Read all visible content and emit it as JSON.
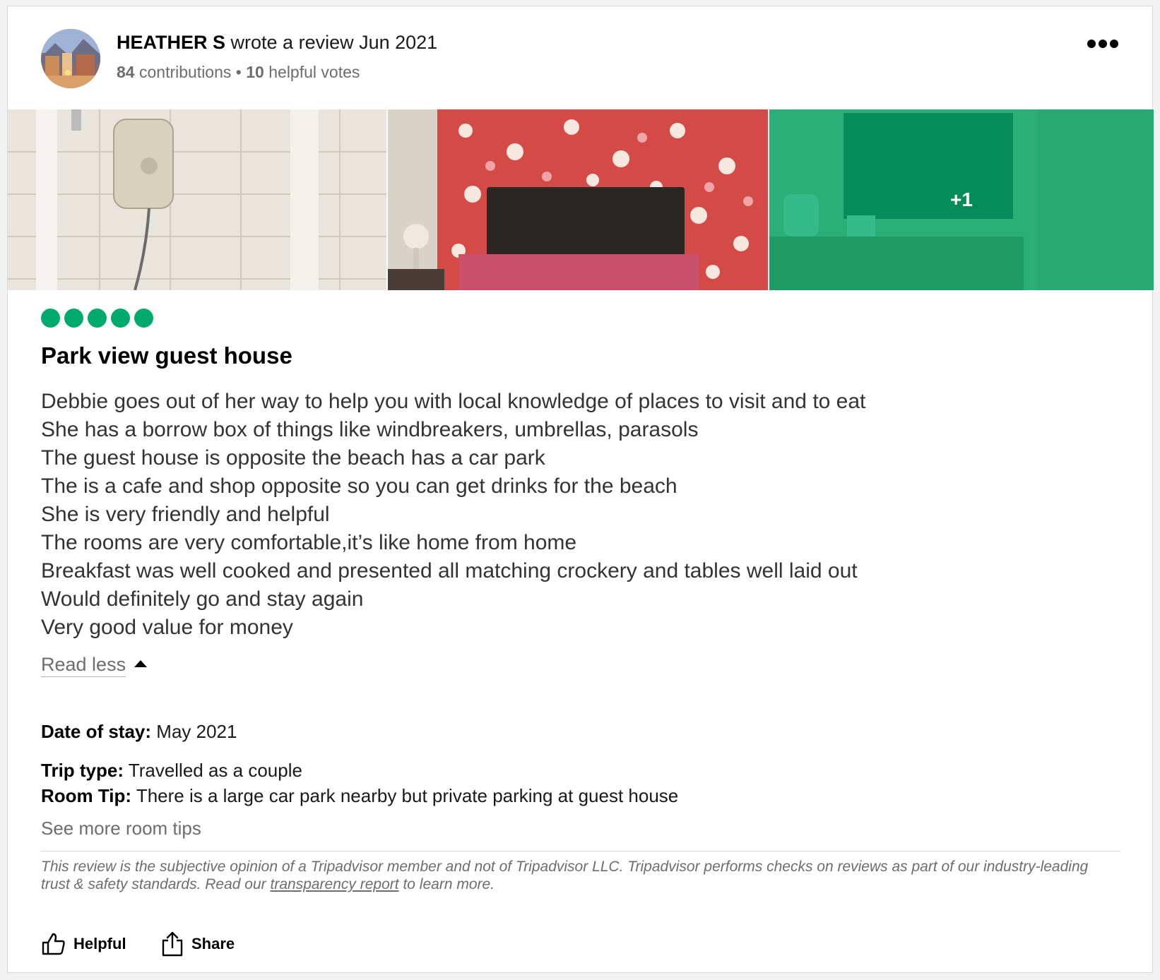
{
  "review": {
    "author": "HEATHER S",
    "action_text": "wrote a review Jun 2021",
    "contributions_count": "84",
    "contributions_label": "contributions",
    "separator": "•",
    "helpful_votes_count": "10",
    "helpful_votes_label": "helpful votes",
    "photo_extra_count": "+1",
    "rating": 5,
    "rating_max": 5,
    "title": "Park view guest house",
    "body_lines": [
      "Debbie goes out of her way to help you with local knowledge of places to visit and to eat",
      "She has a borrow box of things like windbreakers, umbrellas, parasols",
      "The guest house is opposite the beach has a car park",
      "The is a cafe and shop opposite so you can get drinks for the beach",
      "She is very friendly and helpful",
      "The rooms are very comfortable,it’s like home from home",
      "Breakfast was well cooked and presented all matching crockery and tables well laid out",
      "Would definitely go and stay again",
      "Very good value for money"
    ],
    "read_less_label": "Read less",
    "date_of_stay_label": "Date of stay:",
    "date_of_stay_value": "May 2021",
    "trip_type_label": "Trip type:",
    "trip_type_value": "Travelled as a couple",
    "room_tip_label": "Room Tip:",
    "room_tip_value": "There is a large car park nearby but private parking at guest house",
    "see_more_tips_label": "See more room tips",
    "disclaimer_before": "This review is the subjective opinion of a Tripadvisor member and not of Tripadvisor LLC. Tripadvisor performs checks on reviews as part of our industry-leading trust & safety standards. Read our",
    "disclaimer_link": "transparency report",
    "disclaimer_after": "to learn more.",
    "helpful_label": "Helpful",
    "share_label": "Share"
  },
  "icons": {
    "more": "more-options-icon",
    "helpful": "thumbs-up-icon",
    "share": "share-icon",
    "read_less": "caret-up-icon"
  },
  "colors": {
    "rating_green": "#00aa6c",
    "muted_text": "#6d6d6d",
    "photo_overlay": "#00aa6c"
  }
}
